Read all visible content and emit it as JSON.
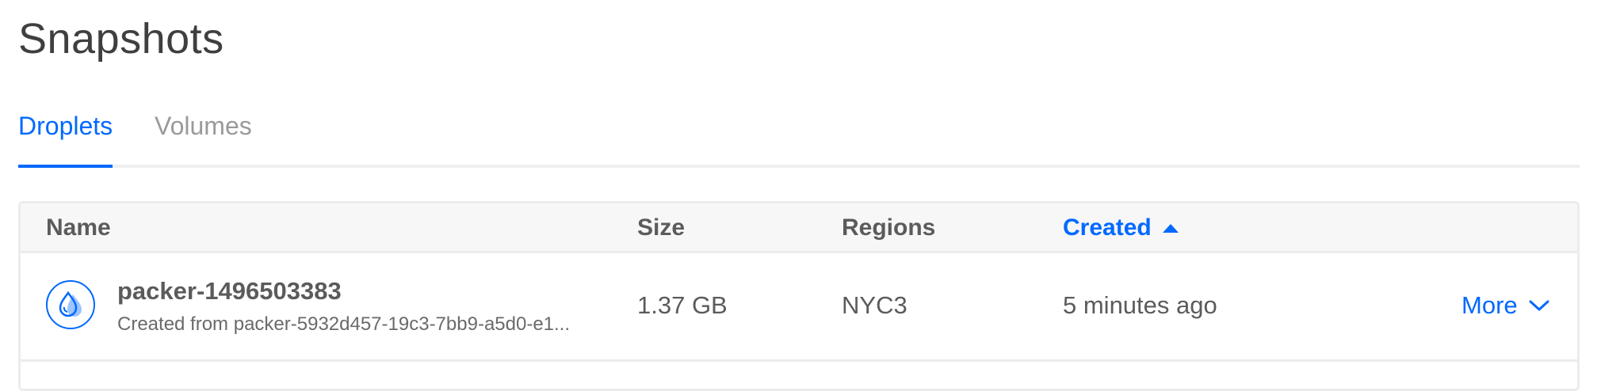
{
  "page": {
    "title": "Snapshots"
  },
  "tabs": [
    {
      "label": "Droplets",
      "active": true
    },
    {
      "label": "Volumes",
      "active": false
    }
  ],
  "table": {
    "columns": [
      "Name",
      "Size",
      "Regions",
      "Created"
    ],
    "sorted_column": "Created",
    "sort_direction": "ascending",
    "rows": [
      {
        "name": "packer-1496503383",
        "description": "Created from packer-5932d457-19c3-7bb9-a5d0-e1...",
        "size": "1.37 GB",
        "regions": "NYC3",
        "created": "5 minutes ago",
        "action": "More"
      }
    ]
  },
  "colors": {
    "accent": "#0069ff",
    "text": "#5b5b5b",
    "muted": "#9a9a9a",
    "border": "#ececec"
  },
  "icons": {
    "row_icon": "droplet-icon",
    "sort_icon": "caret-up-icon",
    "more_icon": "chevron-down-icon"
  }
}
